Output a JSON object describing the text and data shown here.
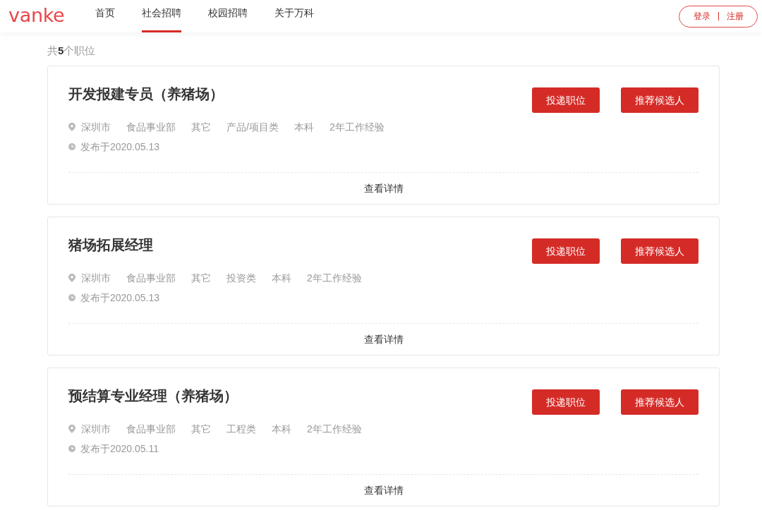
{
  "header": {
    "logo": "vanke",
    "nav": [
      {
        "label": "首页",
        "selected": false
      },
      {
        "label": "社会招聘",
        "selected": true
      },
      {
        "label": "校园招聘",
        "selected": false
      },
      {
        "label": "关于万科",
        "selected": false
      }
    ],
    "auth": {
      "login": "登录",
      "register": "注册"
    }
  },
  "summary": "共**5**个职位",
  "jobs": [
    {
      "title": "开发报建专员（养猪场）",
      "location": "深圳市",
      "tags": [
        "食品事业部",
        "其它",
        "产品/项目类",
        "本科",
        "2年工作经验"
      ],
      "posted": "发布于2020.05.13",
      "buttons": [
        "投递职位",
        "推荐候选人"
      ],
      "details": "查看详情"
    },
    {
      "title": "猪场拓展经理",
      "location": "深圳市",
      "tags": [
        "食品事业部",
        "其它",
        "投资类",
        "本科",
        "2年工作经验"
      ],
      "posted": "发布于2020.05.13",
      "buttons": [
        "投递职位",
        "推荐候选人"
      ],
      "details": "查看详情"
    },
    {
      "title": "预结算专业经理（养猪场）",
      "location": "深圳市",
      "tags": [
        "食品事业部",
        "其它",
        "工程类",
        "本科",
        "2年工作经验"
      ],
      "posted": "发布于2020.05.11",
      "buttons": [
        "投递职位",
        "推荐候选人"
      ],
      "details": "查看详情"
    }
  ]
}
